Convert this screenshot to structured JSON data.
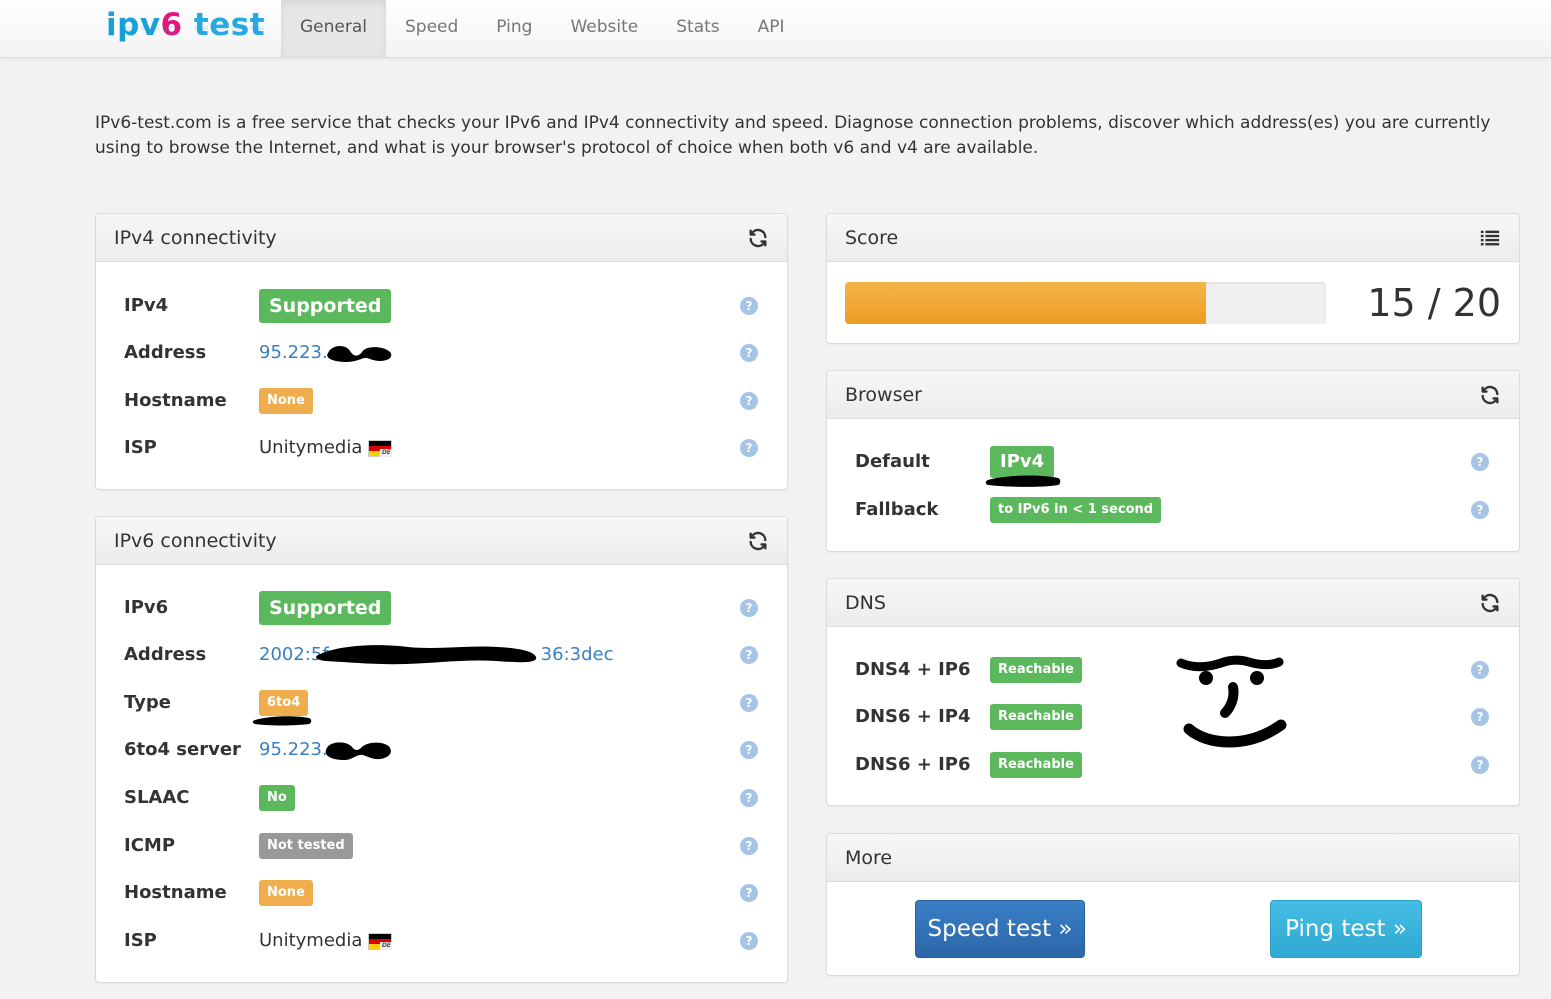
{
  "brand": {
    "part1": "ipv",
    "part2": "6",
    "part3": " test"
  },
  "nav": {
    "items": [
      "General",
      "Speed",
      "Ping",
      "Website",
      "Stats",
      "API"
    ],
    "active": "General"
  },
  "intro": "IPv6-test.com is a free service that checks your IPv6 and IPv4 connectivity and speed. Diagnose connection problems, discover which address(es) you are currently using to browse the Internet, and what is your browser's protocol of choice when both v6 and v4 are available.",
  "ipv4": {
    "title": "IPv4 connectivity",
    "rows": {
      "ipv4": {
        "label": "IPv4",
        "value": "Supported"
      },
      "address": {
        "label": "Address",
        "value": "95.223."
      },
      "hostname": {
        "label": "Hostname",
        "value": "None"
      },
      "isp": {
        "label": "ISP",
        "value": "Unitymedia",
        "country": "DE"
      }
    }
  },
  "ipv6": {
    "title": "IPv6 connectivity",
    "rows": {
      "ipv6": {
        "label": "IPv6",
        "value": "Supported"
      },
      "address_start": "2002:5f",
      "address_end": "36:3dec",
      "address": {
        "label": "Address"
      },
      "type": {
        "label": "Type",
        "value": "6to4"
      },
      "server": {
        "label": "6to4 server",
        "value": "95.223."
      },
      "slaac": {
        "label": "SLAAC",
        "value": "No"
      },
      "icmp": {
        "label": "ICMP",
        "value": "Not tested"
      },
      "hostname": {
        "label": "Hostname",
        "value": "None"
      },
      "isp": {
        "label": "ISP",
        "value": "Unitymedia",
        "country": "DE"
      }
    }
  },
  "score": {
    "title": "Score",
    "value": 15,
    "max": 20,
    "text": "15 / 20"
  },
  "browser": {
    "title": "Browser",
    "default": {
      "label": "Default",
      "value": "IPv4"
    },
    "fallback": {
      "label": "Fallback",
      "value": "to IPv6 in < 1 second"
    }
  },
  "dns": {
    "title": "DNS",
    "rows": [
      {
        "label": "DNS4 + IP6",
        "value": "Reachable"
      },
      {
        "label": "DNS6 + IP4",
        "value": "Reachable"
      },
      {
        "label": "DNS6 + IP6",
        "value": "Reachable"
      }
    ]
  },
  "more": {
    "title": "More",
    "speed_button": "Speed test »",
    "ping_button": "Ping test »"
  },
  "help_glyph": "?",
  "colors": {
    "success": "#5cb85c",
    "warning": "#f0ad4e",
    "default": "#999999",
    "link": "#3a7fc2",
    "brand_blue": "#1aa0d8",
    "brand_pink": "#e4157b",
    "progress": "#ec9d22"
  },
  "icons": {
    "refresh": "refresh-icon",
    "list": "list-icon",
    "help": "help-icon",
    "flag": "germany-flag-icon"
  }
}
